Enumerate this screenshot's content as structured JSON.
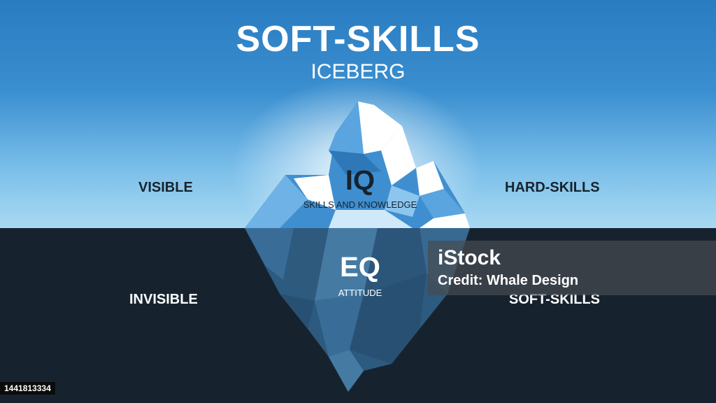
{
  "header": {
    "title": "SOFT-SKILLS",
    "subtitle": "ICEBERG"
  },
  "left": {
    "top_label": "VISIBLE",
    "bottom_label": "INVISIBLE"
  },
  "right": {
    "top_label": "HARD-SKILLS",
    "bottom_label": "SOFT-SKILLS"
  },
  "iceberg": {
    "top_heading": "IQ",
    "top_caption": "SKILLS AND KNOWLEDGE",
    "bottom_heading": "EQ",
    "bottom_caption": "ATTITUDE"
  },
  "watermark": {
    "logo": "iStock",
    "credit": "Credit: Whale Design"
  },
  "stock_id": "1441813334",
  "colors": {
    "sky_top": "#2a7cc0",
    "sky_bottom": "#a9d9f2",
    "sea": "#16232f",
    "ice_light": "#ffffff",
    "ice_blue": "#3f8fd0"
  }
}
